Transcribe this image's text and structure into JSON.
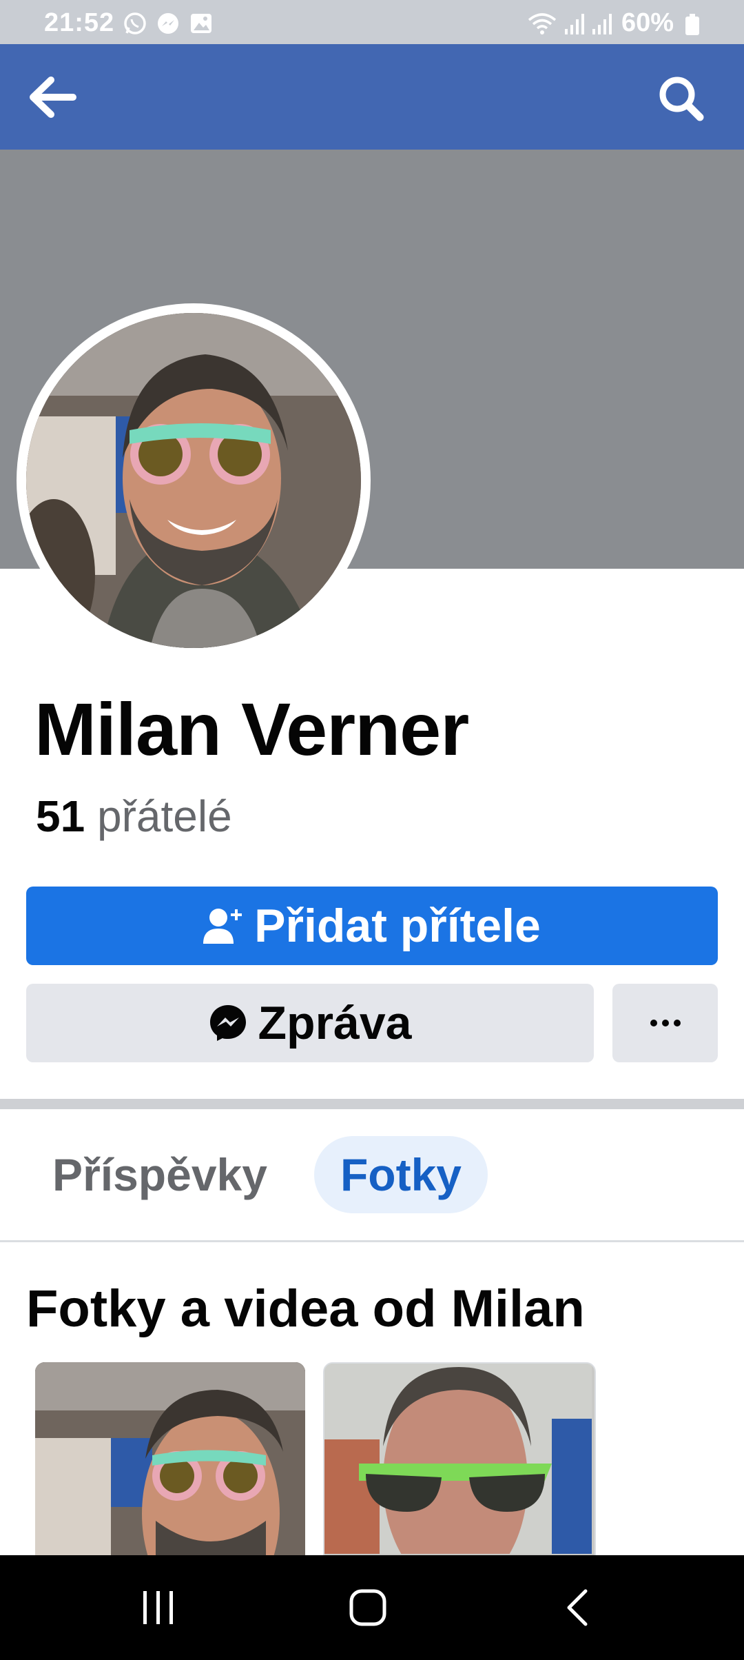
{
  "status_bar": {
    "time": "21:52",
    "battery": "60%",
    "icons": [
      "whatsapp-icon",
      "messenger-icon",
      "gallery-icon",
      "wifi-icon",
      "signal-icon",
      "signal-icon",
      "battery-icon"
    ]
  },
  "app_bar": {
    "back_icon": "arrow-left-icon",
    "search_icon": "search-icon"
  },
  "profile": {
    "name": "Milan Verner",
    "friends_count": "51",
    "friends_label": "přátelé"
  },
  "actions": {
    "add_friend": "Přidat přítele",
    "message": "Zpráva",
    "more": "···"
  },
  "tabs": [
    {
      "label": "Příspěvky",
      "active": false
    },
    {
      "label": "Fotky",
      "active": true
    }
  ],
  "photos_section": {
    "title": "Fotky a videa od Milan"
  },
  "colors": {
    "brand_blue": "#4267b2",
    "button_blue": "#1b74e4",
    "active_tab_text": "#1660c4"
  }
}
